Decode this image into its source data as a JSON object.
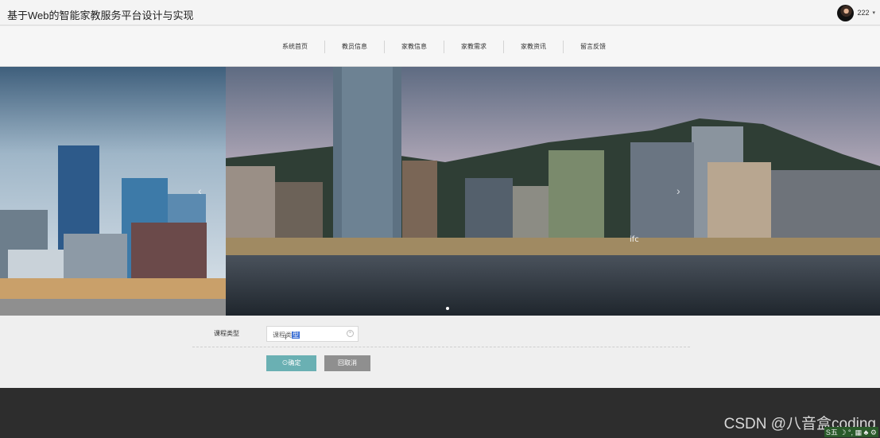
{
  "header": {
    "title": "基于Web的智能家教服务平台设计与实现",
    "user_name": "222",
    "caret": "▾"
  },
  "nav": {
    "items": [
      {
        "label": "系统首页"
      },
      {
        "label": "教员信息"
      },
      {
        "label": "家教信息"
      },
      {
        "label": "家教需求"
      },
      {
        "label": "家教资讯"
      },
      {
        "label": "留言反馈"
      }
    ]
  },
  "banner": {
    "prev_icon": "‹",
    "next_icon": "›",
    "building_sign": "ifc"
  },
  "form": {
    "field_label": "课程类型",
    "select_value_prefix": "课程类",
    "select_value_selected": "型",
    "confirm_label": "⊙确定",
    "cancel_label": "回取消"
  },
  "footer": {
    "watermark": "CSDN @八音盒coding",
    "ime_status": "S五 ☽ °, ▦ ♣ ⚙"
  },
  "colors": {
    "confirm_button": "#6ab0b3",
    "cancel_button": "#8f8f8f",
    "footer_bg": "#2d2d2d",
    "selection_highlight": "#3b6fd4"
  }
}
